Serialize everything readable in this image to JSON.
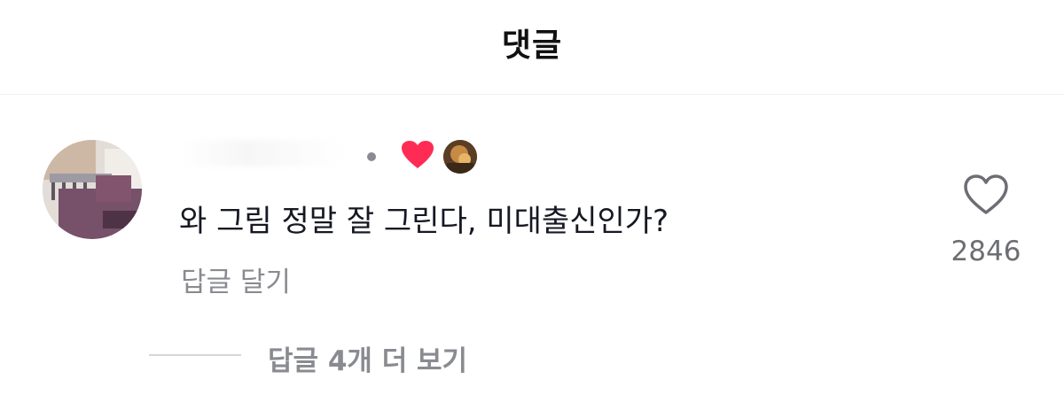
{
  "header": {
    "title": "댓글"
  },
  "comment": {
    "author_avatar_icon": "user-avatar",
    "liked_by_creator_icon": "red-heart-icon",
    "creator_avatar_icon": "creator-avatar",
    "text": "와 그림 정말 잘 그린다, 미대출신인가?",
    "reply_label": "답글 달기",
    "like_count": "2846",
    "like_icon": "heart-outline-icon"
  },
  "replies": {
    "view_more_label": "답글 4개 더 보기"
  },
  "colors": {
    "heart_red": "#fe2c55",
    "secondary_text": "#8a8b91",
    "primary_text": "#161823"
  }
}
